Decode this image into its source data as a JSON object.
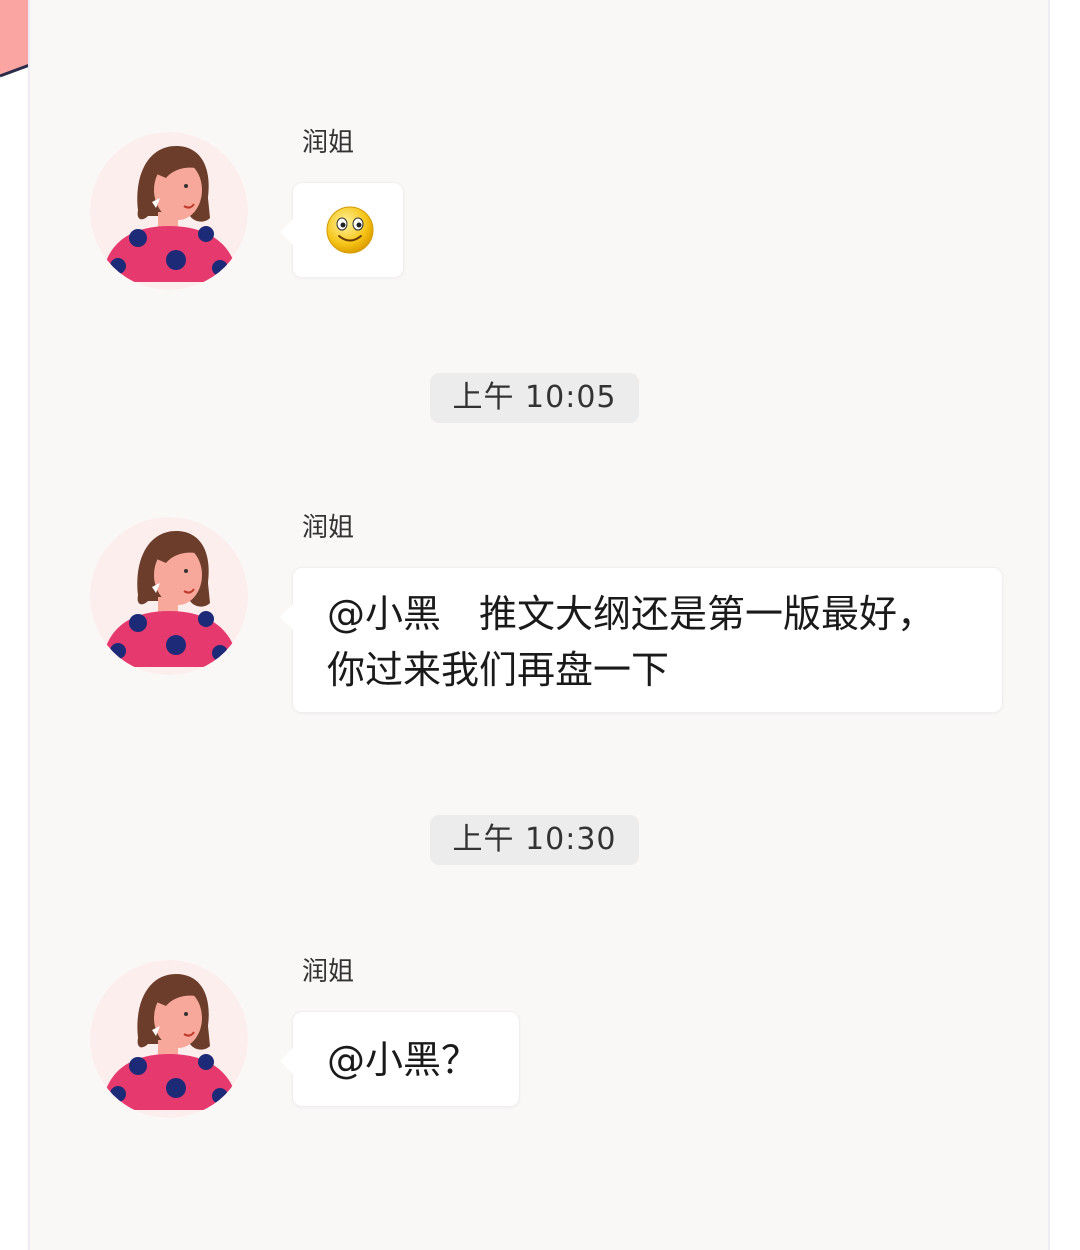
{
  "colors": {
    "panel_background": "#faf8f7",
    "bubble_background": "#ffffff",
    "time_pill_background": "#ececec",
    "accent_pink": "#fba5a3",
    "shirt_pink": "#e63a6f",
    "polka_dot_navy": "#1c2a78",
    "hair_brown": "#6b3d2a"
  },
  "messages": [
    {
      "sender": "润姐",
      "avatar_icon": "woman-avatar-icon",
      "content_icon": "smiley-emoji-icon",
      "text": ""
    },
    {
      "sender": "润姐",
      "avatar_icon": "woman-avatar-icon",
      "text": "@小黑　推文大纲还是第一版最好，\n你过来我们再盘一下"
    },
    {
      "sender": "润姐",
      "avatar_icon": "woman-avatar-icon",
      "text": "@小黑？"
    }
  ],
  "timestamps": [
    "上午 10:05",
    "上午 10:30"
  ]
}
